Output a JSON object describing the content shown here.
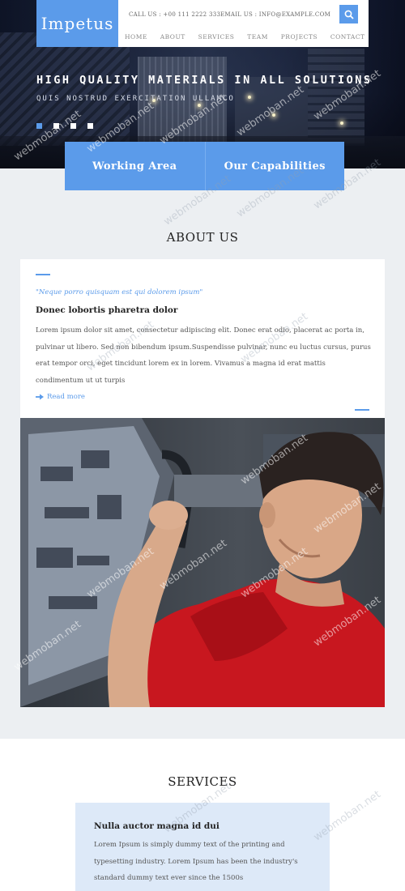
{
  "brand": {
    "name": "Impetus"
  },
  "header": {
    "call": "CALL US : +00 111 2222 333",
    "email": "EMAIL US : INFO@EXAMPLE.COM",
    "nav": [
      "HOME",
      "ABOUT",
      "SERVICES",
      "TEAM",
      "PROJECTS",
      "CONTACT"
    ]
  },
  "hero": {
    "title": "HIGH QUALITY MATERIALS IN ALL SOLUTIONS",
    "subtitle": "QUIS NOSTRUD EXERCITATION ULLAMCO",
    "slides": 4,
    "active_slide": 1
  },
  "features": [
    "Working Area",
    "Our Capabilities"
  ],
  "about": {
    "title": "ABOUT US",
    "quote": "\"Neque porro quisquam est qui dolorem ipsum\"",
    "heading": "Donec lobortis pharetra dolor",
    "body": "Lorem ipsum dolor sit amet, consectetur adipiscing elit. Donec erat odio, placerat ac porta in, pulvinar ut libero. Sed non bibendum ipsum.Suspendisse pulvinar, nunc eu luctus cursus, purus erat tempor orci, eget tincidunt lorem ex in lorem. Vivamus a magna id erat mattis condimentum ut ut turpis",
    "read_more": "Read more"
  },
  "services": {
    "title": "SERVICES",
    "card_heading": "Nulla auctor magna id dui",
    "card_body": "Lorem Ipsum is simply dummy text of the printing and typesetting industry. Lorem Ipsum has been the industry's standard dummy text ever since the 1500s"
  },
  "watermark": "webmoban.net",
  "colors": {
    "accent": "#5b9bea",
    "service_bg": "#dde9f8"
  },
  "icons": {
    "search": "search-icon",
    "read_more": "arrow-right-icon"
  }
}
